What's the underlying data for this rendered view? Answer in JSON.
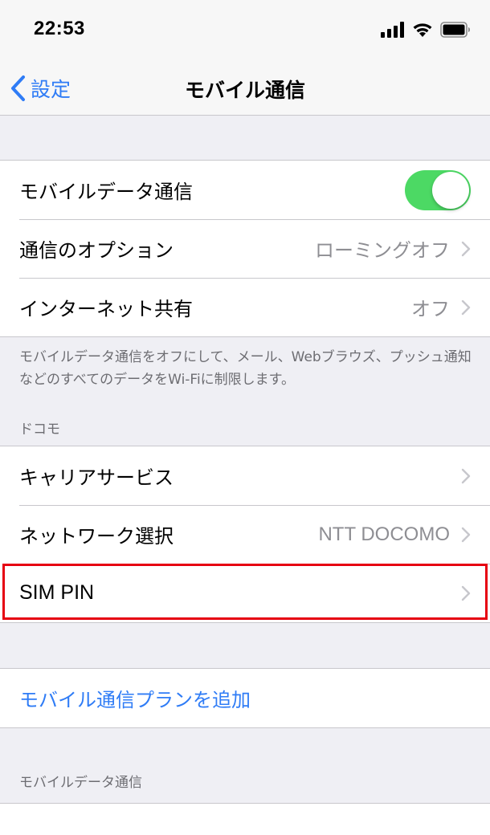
{
  "status_bar": {
    "time": "22:53"
  },
  "nav": {
    "back_label": "設定",
    "title": "モバイル通信"
  },
  "colors": {
    "accent": "#2f7cf6",
    "toggle_on": "#4cd964",
    "highlight": "#e60012"
  },
  "group1": {
    "cellular_data": {
      "label": "モバイルデータ通信",
      "enabled": true
    },
    "options": {
      "label": "通信のオプション",
      "value": "ローミングオフ"
    },
    "hotspot": {
      "label": "インターネット共有",
      "value": "オフ"
    }
  },
  "group1_footer": "モバイルデータ通信をオフにして、メール、Webブラウズ、プッシュ通知などのすべてのデータをWi-Fiに制限します。",
  "carrier_section": {
    "header": "ドコモ",
    "carrier_services": {
      "label": "キャリアサービス"
    },
    "network_selection": {
      "label": "ネットワーク選択",
      "value": "NTT DOCOMO"
    },
    "sim_pin": {
      "label": "SIM PIN"
    }
  },
  "add_plan": {
    "label": "モバイル通信プランを追加"
  },
  "cellular_data_section": {
    "header": "モバイルデータ通信"
  }
}
